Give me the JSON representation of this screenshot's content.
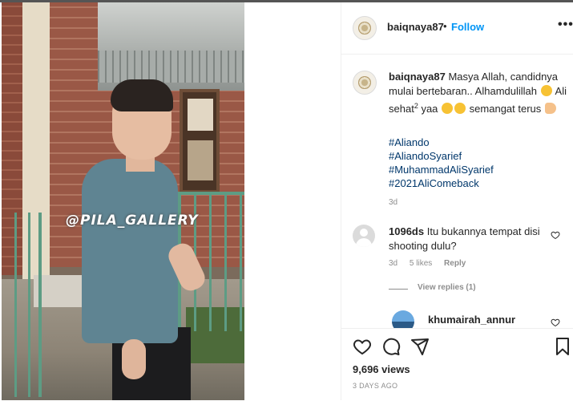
{
  "post": {
    "media": {
      "watermark": "@PILA_GALLERY"
    },
    "header": {
      "username": "baiqnaya87",
      "separator": "•",
      "follow_label": "Follow",
      "more_label": "•••"
    },
    "caption": {
      "username": "baiqnaya87",
      "text_line1": "Masya Allah, candidnya mulai bertebaran.. Alhamdulillah",
      "text_line2a": "Ali sehat",
      "superscript": "2",
      "text_line2b": "yaa",
      "text_line2c": "semangat terus",
      "hashtags": [
        "#Aliando",
        "#AliandoSyarief",
        "#MuhammadAliSyarief",
        "#2021AliComeback"
      ],
      "time": "3d"
    },
    "comments": [
      {
        "username": "1096ds",
        "text": "Itu bukannya tempat disi shooting dulu?",
        "time": "3d",
        "likes": "5 likes",
        "reply_label": "Reply",
        "view_replies": "View replies (1)"
      },
      {
        "username": "khumairah_annur"
      }
    ],
    "footer": {
      "views": "9,696 views",
      "date": "3 DAYS AGO"
    },
    "icons": {
      "like": "heart-icon",
      "comment": "comment-bubble-icon",
      "share": "paper-plane-icon",
      "save": "bookmark-icon"
    },
    "colors": {
      "follow_blue": "#0095f6",
      "hashtag": "#00376b",
      "muted": "#8e8e8e",
      "text": "#262626"
    }
  }
}
